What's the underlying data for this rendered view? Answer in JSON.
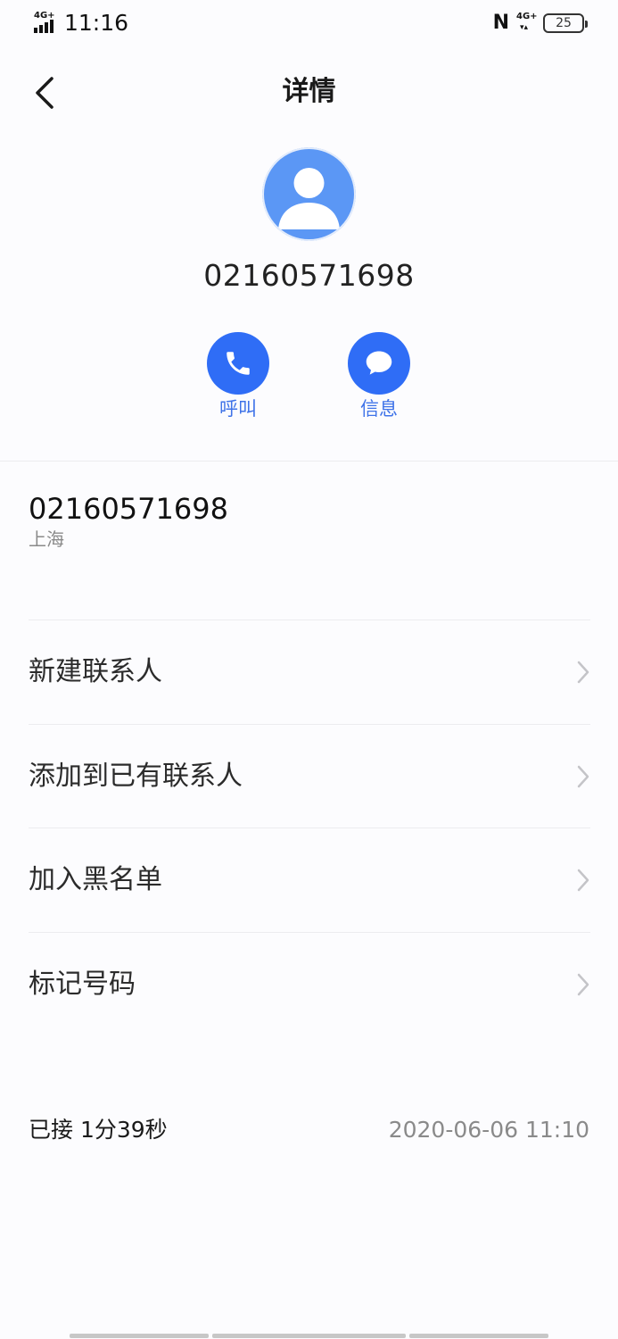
{
  "status_bar": {
    "network_left": "4G+",
    "time": "11:16",
    "nfc": "N",
    "network_right": "4G+",
    "battery": "25"
  },
  "header": {
    "title": "详情"
  },
  "contact": {
    "number": "02160571698"
  },
  "actions": {
    "call_label": "呼叫",
    "message_label": "信息"
  },
  "number_info": {
    "number": "02160571698",
    "location": "上海"
  },
  "menu": [
    {
      "label": "新建联系人"
    },
    {
      "label": "添加到已有联系人"
    },
    {
      "label": "加入黑名单"
    },
    {
      "label": "标记号码"
    }
  ],
  "call_log": {
    "status": "已接 1分39秒",
    "datetime": "2020-06-06 11:10"
  },
  "colors": {
    "accent": "#2f6df6",
    "avatar": "#5b97f5",
    "action_label": "#3f73e8"
  }
}
